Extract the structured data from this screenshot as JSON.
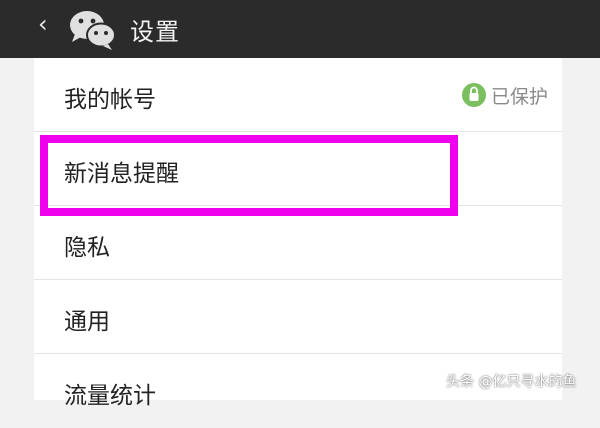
{
  "header": {
    "back_icon": "‹",
    "title": "设置",
    "logo": "wechat-logo"
  },
  "settings": {
    "items": [
      {
        "label": "我的帐号",
        "status": "已保护",
        "status_icon": "lock-icon"
      },
      {
        "label": "新消息提醒"
      },
      {
        "label": "隐私"
      },
      {
        "label": "通用"
      },
      {
        "label": "流量统计"
      }
    ]
  },
  "highlight": {
    "target": "新消息提醒",
    "color": "#f000ee"
  },
  "watermark": {
    "text": "头条 @亿只寻水的鱼"
  },
  "colors": {
    "titlebar": "#2b2b2b",
    "status_icon": "#7bbf5e",
    "highlight": "#f000ee"
  }
}
